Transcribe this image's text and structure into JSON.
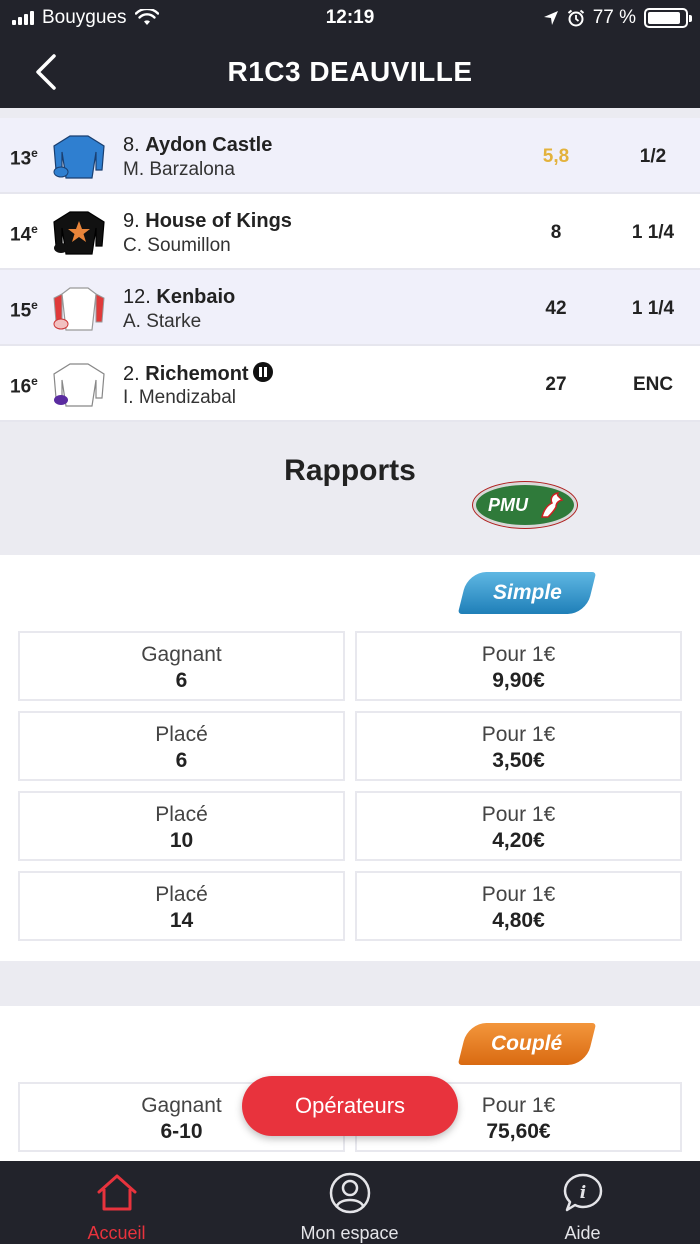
{
  "status_bar": {
    "carrier": "Bouygues",
    "time": "12:19",
    "battery": "77 %"
  },
  "header": {
    "title": "R1C3 DEAUVILLE"
  },
  "runners": [
    {
      "rank": "13",
      "rank_suffix": "e",
      "number": "8.",
      "name": "Aydon Castle",
      "jockey": "M. Barzalona",
      "cote": "5,8",
      "ecart": "1/2"
    },
    {
      "rank": "14",
      "rank_suffix": "e",
      "number": "9.",
      "name": "House of Kings",
      "jockey": "C. Soumillon",
      "cote": "8",
      "ecart": "1 1/4"
    },
    {
      "rank": "15",
      "rank_suffix": "e",
      "number": "12.",
      "name": "Kenbaio",
      "jockey": "A. Starke",
      "cote": "42",
      "ecart": "1 1/4"
    },
    {
      "rank": "16",
      "rank_suffix": "e",
      "number": "2.",
      "name": "Richemont",
      "jockey": "I. Mendizabal",
      "cote": "27",
      "ecart": "ENC"
    }
  ],
  "rapports": {
    "title": "Rapports",
    "operator_logo": "PMU",
    "simple": {
      "label": "Simple",
      "rows": [
        {
          "type": "Gagnant",
          "horses": "6",
          "unit": "Pour 1€",
          "value": "9,90€"
        },
        {
          "type": "Placé",
          "horses": "6",
          "unit": "Pour 1€",
          "value": "3,50€"
        },
        {
          "type": "Placé",
          "horses": "10",
          "unit": "Pour 1€",
          "value": "4,20€"
        },
        {
          "type": "Placé",
          "horses": "14",
          "unit": "Pour 1€",
          "value": "4,80€"
        }
      ]
    },
    "couple": {
      "label": "Couplé",
      "rows": [
        {
          "type": "Gagnant",
          "horses": "6-10",
          "unit": "Pour 1€",
          "value": "75,60€"
        }
      ]
    }
  },
  "floating_button": {
    "label": "Opérateurs"
  },
  "tabbar": {
    "items": [
      {
        "label": "Accueil",
        "icon": "home-icon",
        "active": true
      },
      {
        "label": "Mon espace",
        "icon": "user-icon",
        "active": false
      },
      {
        "label": "Aide",
        "icon": "help-icon",
        "active": false
      }
    ]
  },
  "colors": {
    "accent": "#e8333d",
    "header_bg": "#22232b",
    "cote_highlight": "#e3b23c",
    "simple_badge": "#2a8fc9",
    "couple_badge": "#e57a20",
    "pmu_green": "#2f7a3a"
  }
}
